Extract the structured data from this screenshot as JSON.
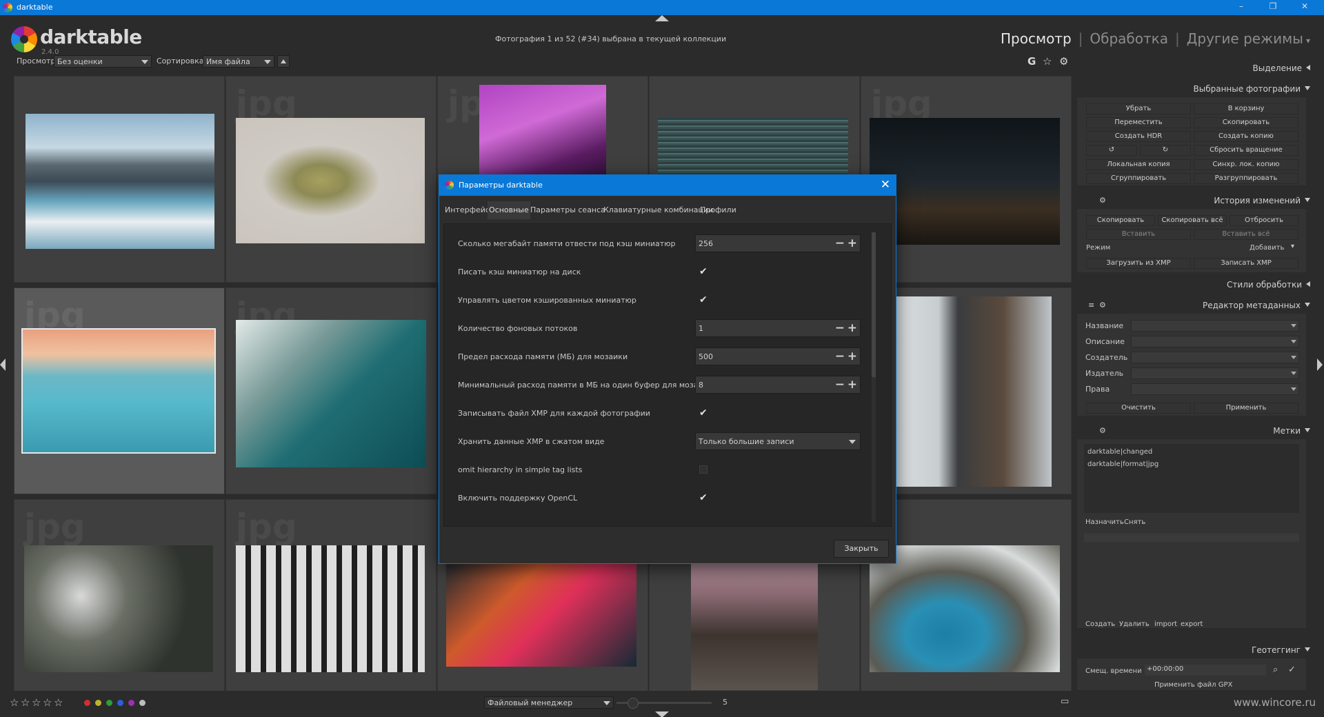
{
  "window": {
    "title": "darktable",
    "min": "–",
    "max": "❐",
    "close": "✕"
  },
  "app": {
    "name": "darktable",
    "version": "2.4.0"
  },
  "header": {
    "info": "Фотография 1 из 52 (#34) выбрана в текущей коллекции",
    "modes": {
      "view": "Просмотр",
      "edit": "Обработка",
      "other": "Другие режимы"
    },
    "filter_label": "Просмотр",
    "filter_value": "Без оценки",
    "sort_label": "Сортировка",
    "sort_value": "Имя файла",
    "icon_g": "G",
    "icon_star": "☆",
    "icon_gear": "⚙"
  },
  "thumbs": {
    "ext": "jpg"
  },
  "right_panel": {
    "selection": "Выделение",
    "selected": {
      "title": "Выбранные фотографии",
      "buttons": [
        "Убрать",
        "В корзину",
        "Переместить",
        "Скопировать",
        "Создать HDR",
        "Создать копию",
        "↺",
        "↻",
        "Сбросить вращение",
        "Локальная копия",
        "Синхр. лок. копию",
        "Сгруппировать",
        "Разгруппировать"
      ]
    },
    "history": {
      "title": "История изменений",
      "buttons": [
        "Скопировать",
        "Скопировать всё",
        "Отбросить",
        "Вставить",
        "Вставить всё"
      ],
      "mode_label": "Режим",
      "mode_value": "Добавить",
      "load_xmp": "Загрузить из XMP",
      "write_xmp": "Записать XMP"
    },
    "styles": "Стили обработки",
    "metadata": {
      "title": "Редактор метаданных",
      "fields": [
        "Название",
        "Описание",
        "Создатель",
        "Издатель",
        "Права"
      ],
      "clear": "Очистить",
      "apply": "Применить"
    },
    "tags": {
      "title": "Метки",
      "items": [
        "darktable|changed",
        "darktable|format|jpg"
      ],
      "attach": "Назначить",
      "detach": "Снять",
      "create": "Создать",
      "delete": "Удалить",
      "import": "import",
      "export": "export"
    },
    "geotag": {
      "title": "Геотеггинг",
      "offset_label": "Смещ. времени",
      "offset_value": "+00:00:00",
      "apply_gpx": "Применить файл GPX"
    }
  },
  "bottom": {
    "stars": [
      "☆",
      "☆",
      "☆",
      "☆",
      "☆"
    ],
    "color_labels": [
      "#d32f2f",
      "#c0b52a",
      "#2e9d3a",
      "#2d5fd6",
      "#9c2fb0",
      "#bdbdbd"
    ],
    "manager": "Файловый менеджер",
    "zoom": "5",
    "watermark": "www.wincore.ru"
  },
  "dialog": {
    "title": "Параметры darktable",
    "tabs": [
      "Интерфейс",
      "Основные",
      "Параметры сеанса",
      "Клавиатурные комбинации",
      "Профили"
    ],
    "active_tab": "Основные",
    "rows": [
      {
        "label": "Сколько мегабайт памяти отвести под кэш миниатюр",
        "type": "spin",
        "value": "256"
      },
      {
        "label": "Писать кэш миниатюр на диск",
        "type": "check",
        "value": "✔"
      },
      {
        "label": "Управлять цветом кэшированных миниатюр",
        "type": "check",
        "value": "✔"
      },
      {
        "label": "Количество фоновых потоков",
        "type": "spin",
        "value": "1"
      },
      {
        "label": "Предел расхода памяти (МБ) для мозаики",
        "type": "spin",
        "value": "500"
      },
      {
        "label": "Минимальный расход памяти в МБ на один буфер для мозаики",
        "type": "spin",
        "value": "8"
      },
      {
        "label": "Записывать файл XMP для каждой фотографии",
        "type": "check",
        "value": "✔"
      },
      {
        "label": "Хранить данные XMP в сжатом виде",
        "type": "select",
        "value": "Только большие записи"
      },
      {
        "label": "omit hierarchy in simple tag lists",
        "type": "uncheck",
        "value": ""
      },
      {
        "label": "Включить поддержку OpenCL",
        "type": "check",
        "value": "✔"
      }
    ],
    "close_label": "Закрыть"
  }
}
